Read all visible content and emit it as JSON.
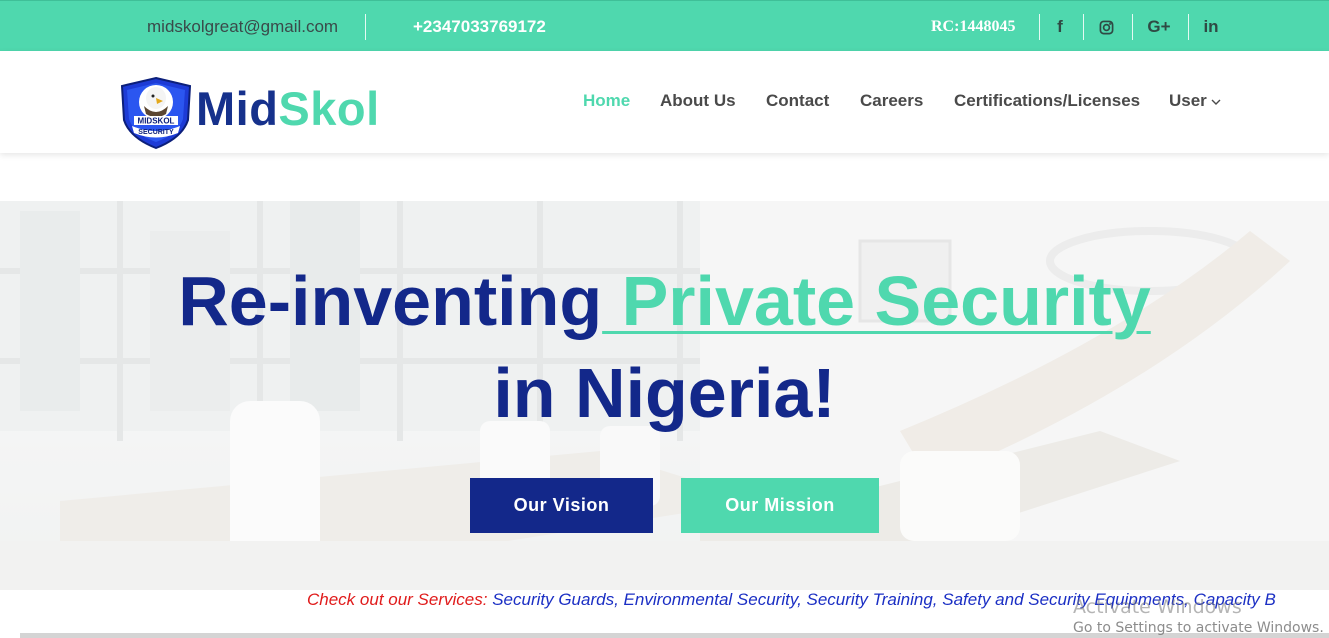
{
  "topbar": {
    "email": "midskolgreat@gmail.com",
    "phone": "+2347033769172",
    "rc": "RC:1448045",
    "social": [
      {
        "icon": "facebook-icon",
        "glyph": "f"
      },
      {
        "icon": "instagram-icon",
        "glyph": ""
      },
      {
        "icon": "google-plus-icon",
        "glyph": "G+"
      },
      {
        "icon": "linkedin-icon",
        "glyph": "in"
      }
    ]
  },
  "header": {
    "logo": {
      "part1": "Mid",
      "part2": "Skol",
      "badge_top": "MIDSKOL",
      "badge_bottom": "SECURITY"
    },
    "nav": [
      {
        "label": "Home",
        "active": true
      },
      {
        "label": "About Us"
      },
      {
        "label": "Contact"
      },
      {
        "label": "Careers"
      },
      {
        "label": "Certifications/Licenses"
      },
      {
        "label": "User",
        "dropdown": true
      }
    ]
  },
  "hero": {
    "headline_part1": "Re-inventing",
    "headline_accent": " Private Security",
    "headline_part2": "in Nigeria!",
    "buttons": {
      "vision": "Our Vision",
      "mission": "Our Mission"
    }
  },
  "marquee": {
    "lead": "Check out our Services:",
    "services": "Security Guards, Environmental Security, Security Training, Safety and Security Equipments, Capacity B"
  },
  "watermark": {
    "title": "Activate Windows",
    "subtitle": "Go to Settings to activate Windows."
  },
  "colors": {
    "accent": "#4fd8ae",
    "brand_blue": "#13288a",
    "service_red": "#e01b1b",
    "service_blue": "#1b2fc4"
  }
}
